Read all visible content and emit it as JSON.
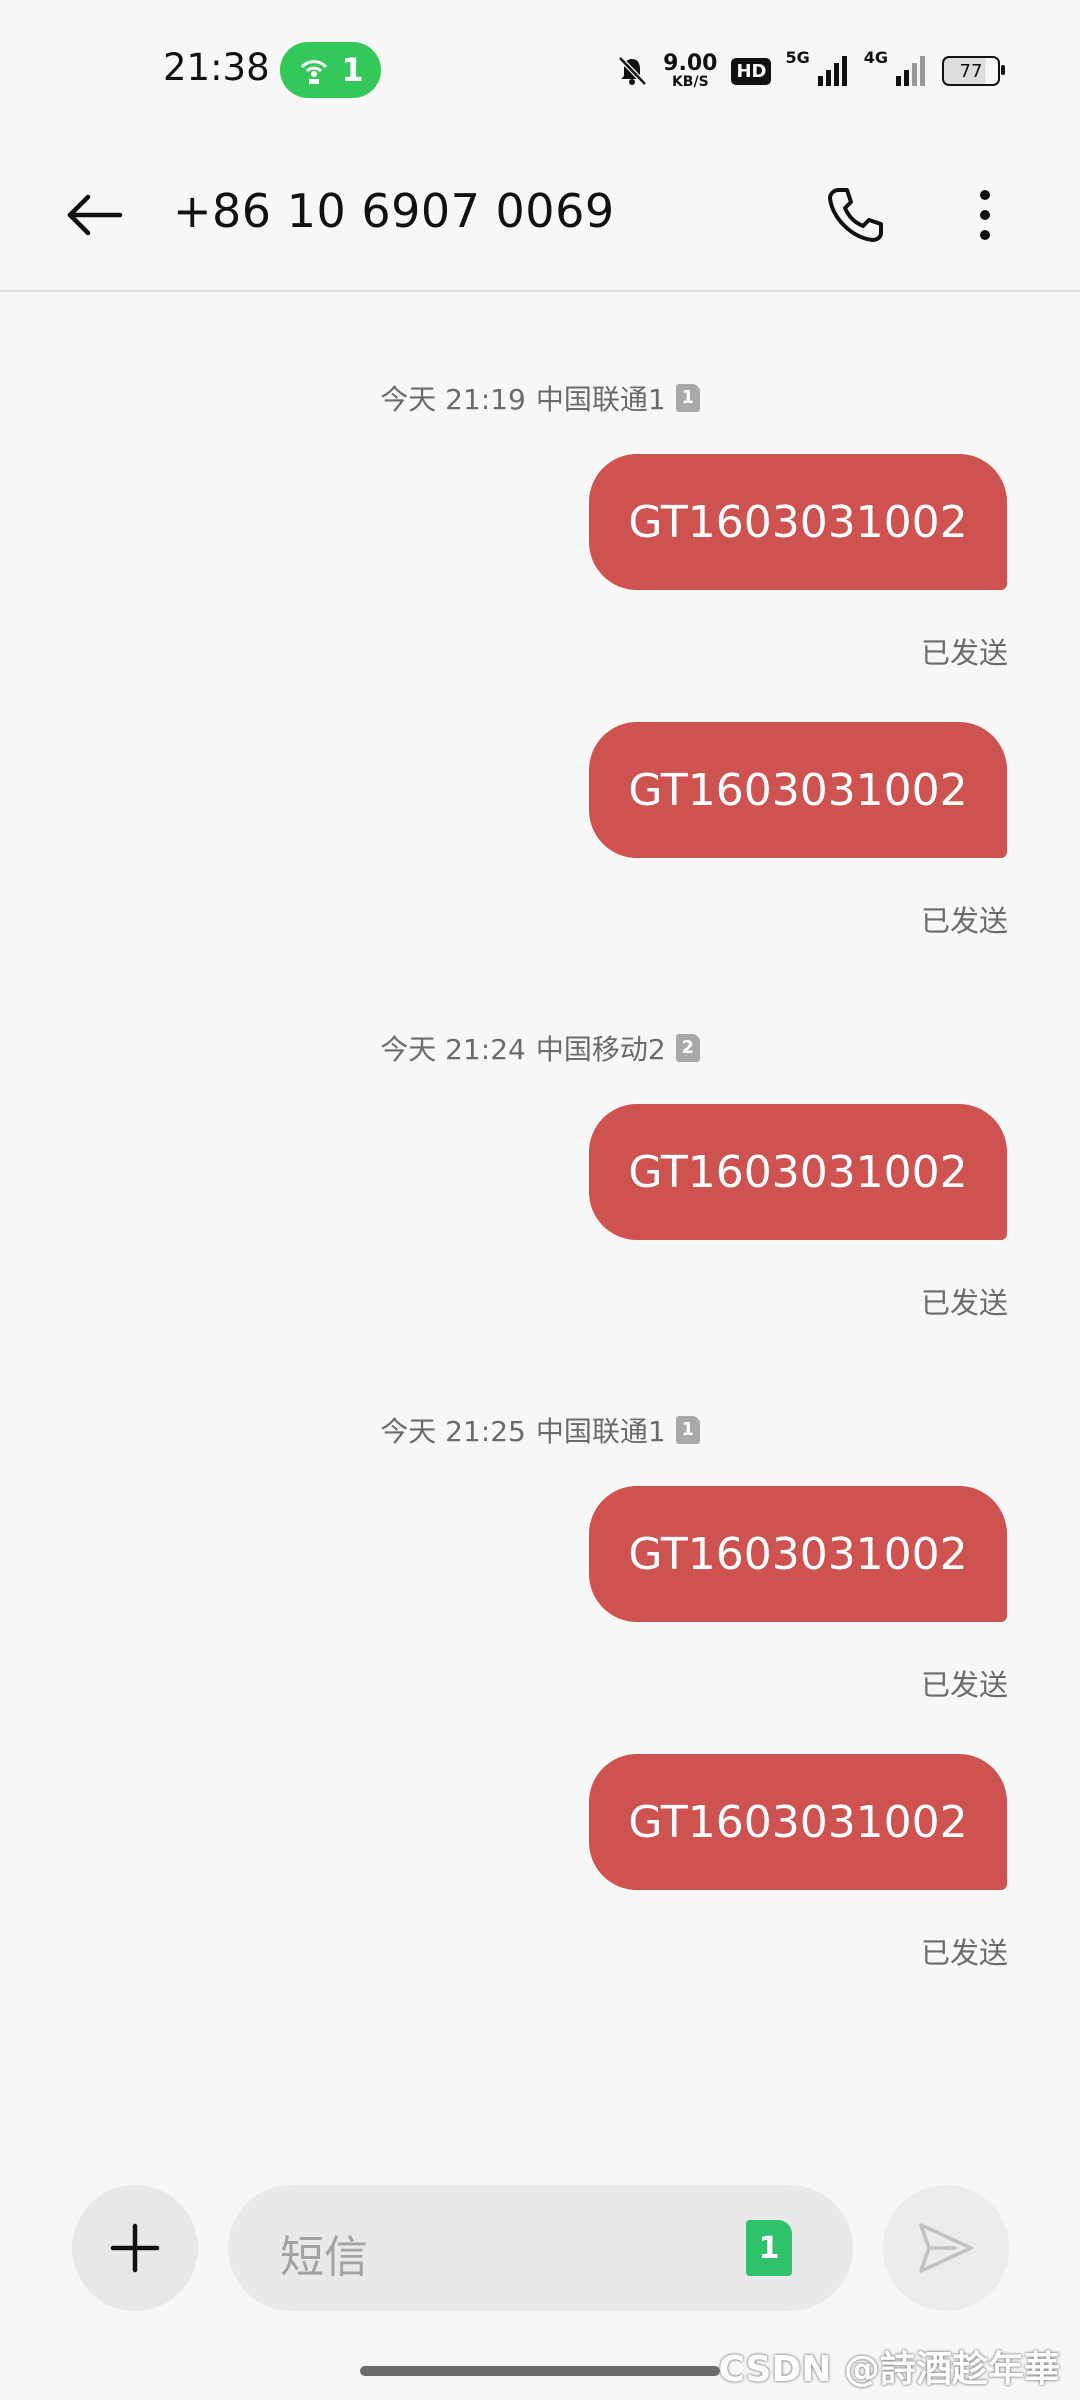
{
  "status_bar": {
    "time": "21:38",
    "hotspot_count": "1",
    "net_speed_value": "9.00",
    "net_speed_unit": "KB/S",
    "hd_label": "HD",
    "net1": "5G",
    "net2": "4G",
    "battery": "77"
  },
  "header": {
    "contact": "+86 10 6907 0069"
  },
  "conversation": [
    {
      "stamp": "今天 21:19",
      "carrier": "中国联通1",
      "sim": "1"
    },
    {
      "stamp": "今天 21:24",
      "carrier": "中国移动2",
      "sim": "2"
    },
    {
      "stamp": "今天 21:25",
      "carrier": "中国联通1",
      "sim": "1"
    }
  ],
  "messages": [
    {
      "text": "GT1603031002",
      "status": "已发送"
    },
    {
      "text": "GT1603031002",
      "status": "已发送"
    },
    {
      "text": "GT1603031002",
      "status": "已发送"
    },
    {
      "text": "GT1603031002",
      "status": "已发送"
    },
    {
      "text": "GT1603031002",
      "status": "已发送"
    }
  ],
  "composer": {
    "placeholder": "短信",
    "sim_selected": "1"
  },
  "watermark": "CSDN @詩酒趁年華",
  "colors": {
    "bubble": "#cd5250",
    "hotspot": "#34c759",
    "sim_selected": "#2ec26a"
  }
}
